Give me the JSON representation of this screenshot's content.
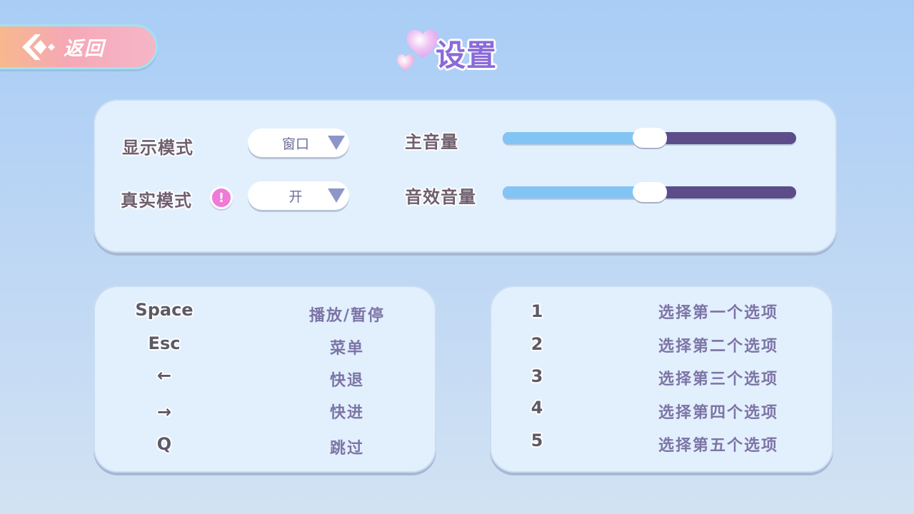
{
  "back_button": {
    "label": "返回",
    "icon": "back-arrow-icon"
  },
  "title": {
    "text": "设置",
    "icon": "heart-icon"
  },
  "colors": {
    "accent": "#8a6ad9",
    "slider_fill": "#82c5f5",
    "slider_track": "#5c4d8a",
    "info_badge": "#f07ad8"
  },
  "settings": {
    "display_mode": {
      "label": "显示模式",
      "value": "窗口"
    },
    "real_mode": {
      "label": "真实模式",
      "value": "开",
      "info_icon": "!"
    },
    "master_volume": {
      "label": "主音量",
      "level_percent": 50
    },
    "sfx_volume": {
      "label": "音效音量",
      "level_percent": 50
    }
  },
  "keybinds_left": [
    {
      "key": "Space",
      "action": "播放/暂停"
    },
    {
      "key": "Esc",
      "action": "菜单"
    },
    {
      "key": "←",
      "action": "快退"
    },
    {
      "key": "→",
      "action": "快进"
    },
    {
      "key": "Q",
      "action": "跳过"
    }
  ],
  "keybinds_right": [
    {
      "key": "1",
      "action": "选择第一个选项"
    },
    {
      "key": "2",
      "action": "选择第二个选项"
    },
    {
      "key": "3",
      "action": "选择第三个选项"
    },
    {
      "key": "4",
      "action": "选择第四个选项"
    },
    {
      "key": "5",
      "action": "选择第五个选项"
    }
  ]
}
